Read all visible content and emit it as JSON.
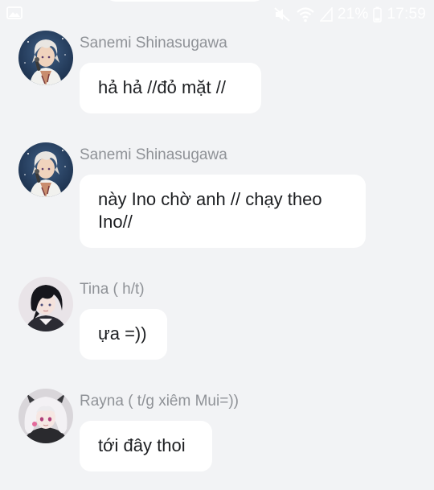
{
  "status_bar": {
    "battery_text": "21%",
    "time": "17:59",
    "icons": [
      "image-icon",
      "mute-icon",
      "wifi-icon",
      "signal-icon",
      "battery-icon"
    ]
  },
  "messages": [
    {
      "sender": "Sanemi Shinasugawa",
      "text": "hả hả //đỏ mặt //",
      "avatar": "anime-boy-white-hair"
    },
    {
      "sender": "Sanemi Shinasugawa",
      "text": "này Ino chờ anh // chạy theo Ino//",
      "avatar": "anime-boy-white-hair"
    },
    {
      "sender": "Tina ( h/t)",
      "text": "ựa =))",
      "avatar": "anime-boy-black-hair"
    },
    {
      "sender": "Rayna ( t/g xiêm Mui=))",
      "text": "tới đây thoi",
      "avatar": "anime-girl-white-hair"
    }
  ],
  "colors": {
    "background": "#f2f3f5",
    "bubble": "#ffffff",
    "sender_name": "#8f9297",
    "message_text": "#1d1f22"
  }
}
